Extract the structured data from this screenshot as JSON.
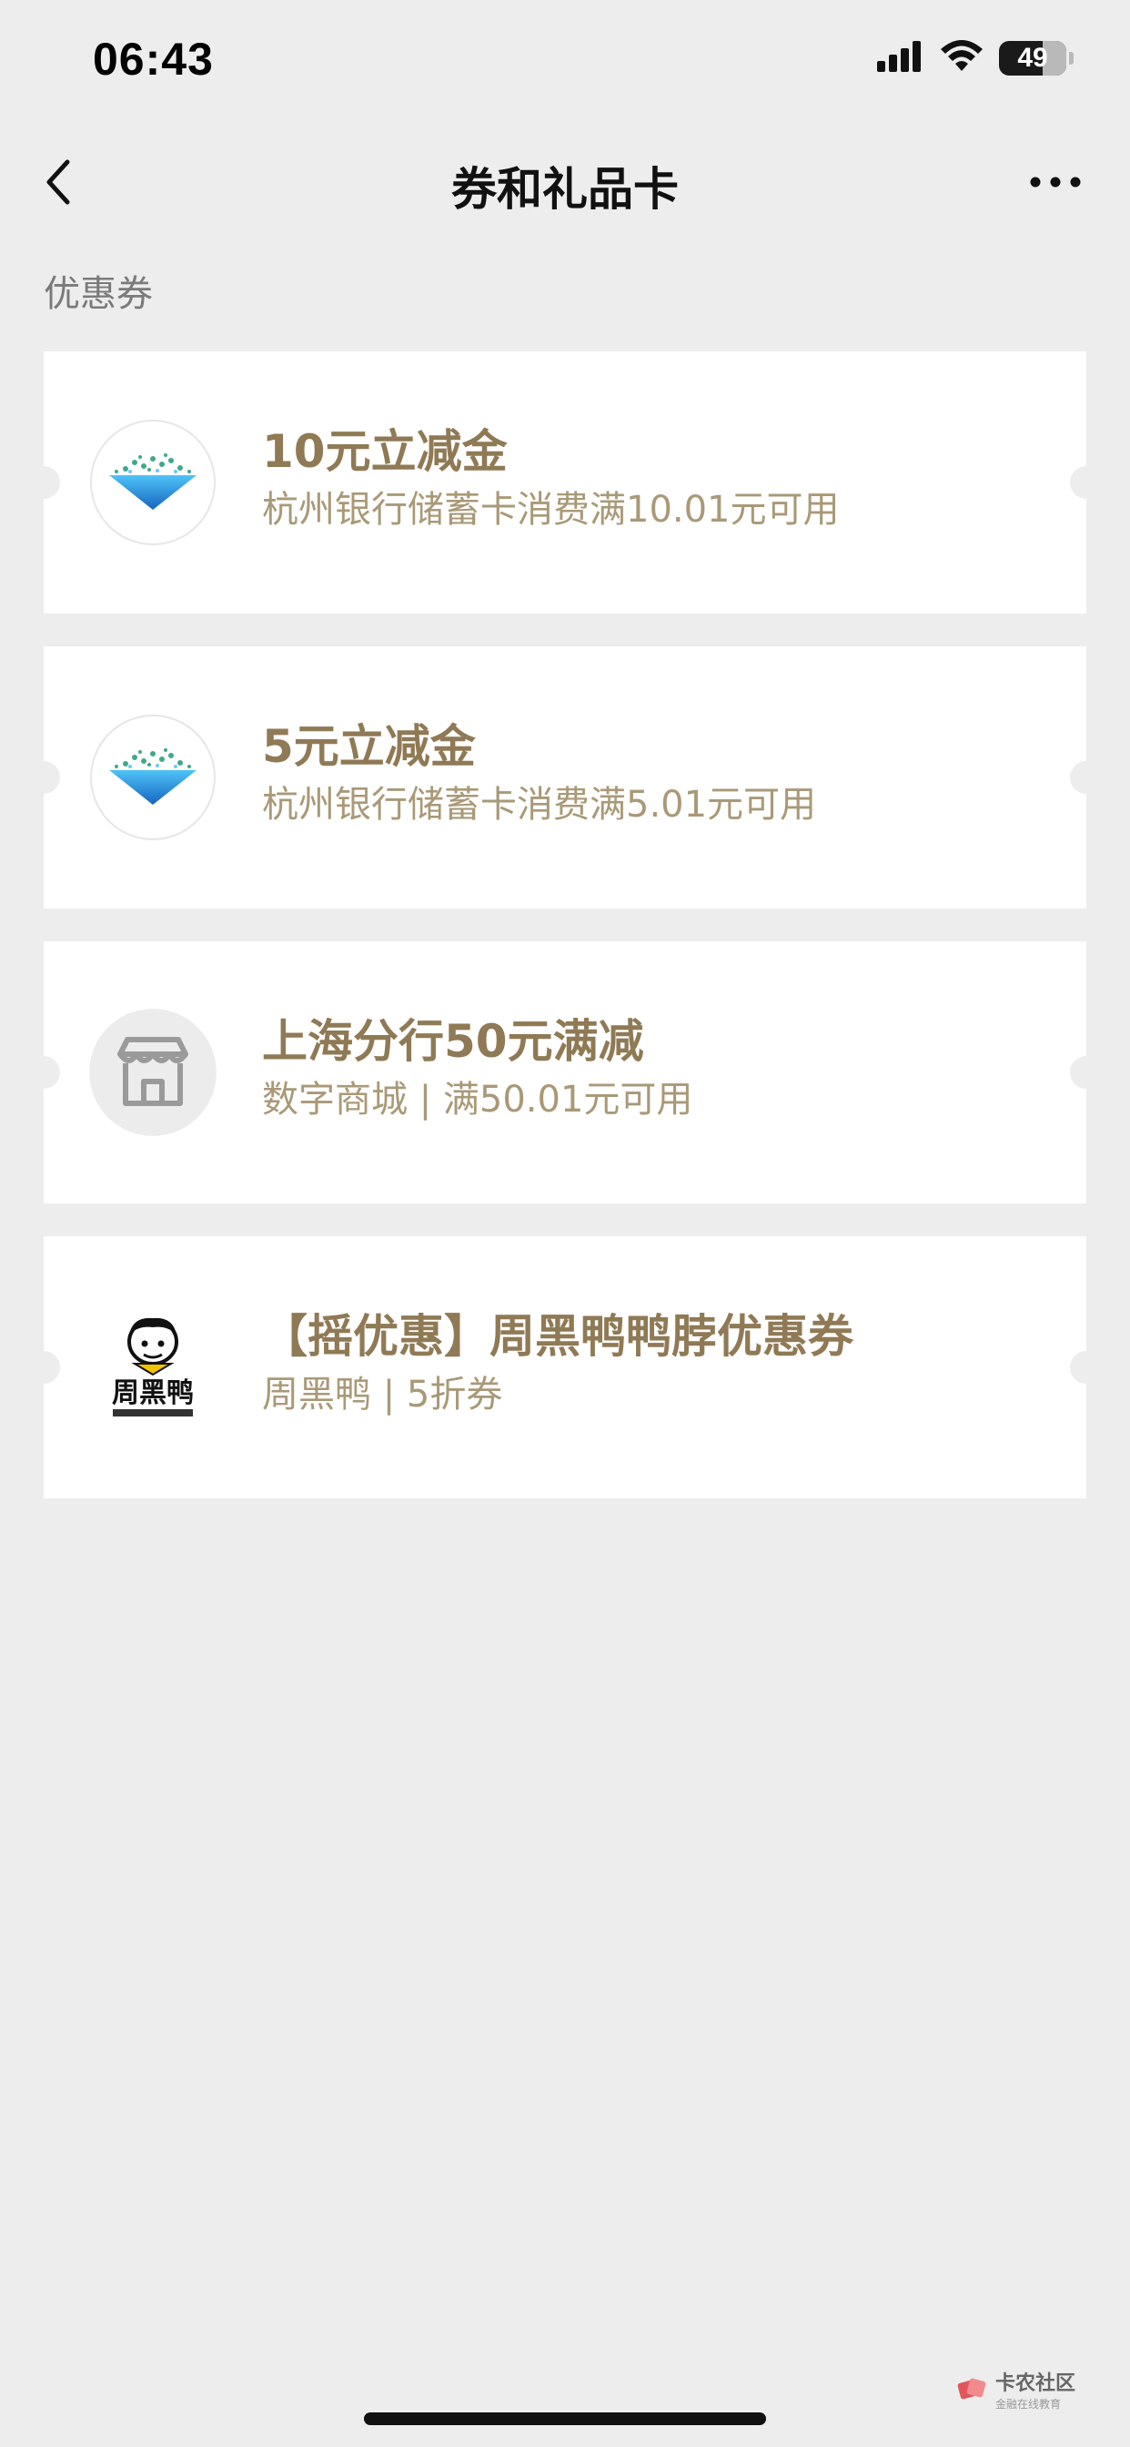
{
  "status_bar": {
    "time": "06:43",
    "battery": "49",
    "icons": [
      "signal-icon",
      "wifi-icon",
      "battery-icon"
    ]
  },
  "nav": {
    "title": "券和礼品卡",
    "back_icon": "chevron-left-icon",
    "more_icon": "more-icon"
  },
  "section_label": "优惠券",
  "coupons": [
    {
      "title": "10元立减金",
      "subtitle": "杭州银行储蓄卡消费满10.01元可用",
      "icon": "bank-logo-icon"
    },
    {
      "title": "5元立减金",
      "subtitle": "杭州银行储蓄卡消费满5.01元可用",
      "icon": "bank-logo-icon"
    },
    {
      "title": "上海分行50元满减",
      "subtitle": "数字商城 | 满50.01元可用",
      "icon": "store-icon"
    },
    {
      "title": "【摇优惠】周黑鸭鸭脖优惠券",
      "subtitle": "周黑鸭 | 5折券",
      "icon": "zhouheiya-logo-icon",
      "logo_text": "周黑鸭"
    }
  ],
  "watermark": {
    "title": "卡农社区",
    "subtitle": "金融在线教育"
  },
  "colors": {
    "background": "#ededed",
    "card": "#ffffff",
    "coupon_title": "#8f7a55",
    "coupon_sub": "#a99977"
  }
}
